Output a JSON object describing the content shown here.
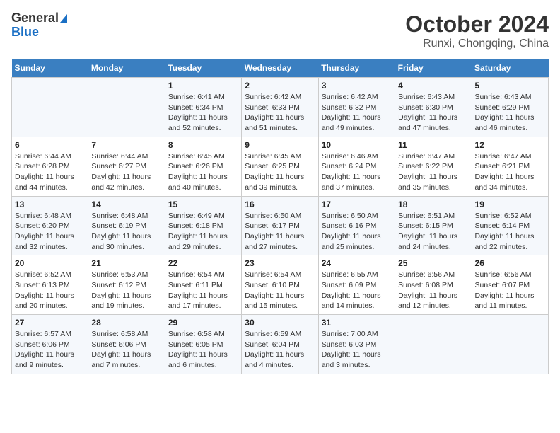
{
  "header": {
    "logo_general": "General",
    "logo_blue": "Blue",
    "title": "October 2024",
    "subtitle": "Runxi, Chongqing, China"
  },
  "weekdays": [
    "Sunday",
    "Monday",
    "Tuesday",
    "Wednesday",
    "Thursday",
    "Friday",
    "Saturday"
  ],
  "weeks": [
    [
      {
        "day": "",
        "info": ""
      },
      {
        "day": "",
        "info": ""
      },
      {
        "day": "1",
        "info": "Sunrise: 6:41 AM\nSunset: 6:34 PM\nDaylight: 11 hours and 52 minutes."
      },
      {
        "day": "2",
        "info": "Sunrise: 6:42 AM\nSunset: 6:33 PM\nDaylight: 11 hours and 51 minutes."
      },
      {
        "day": "3",
        "info": "Sunrise: 6:42 AM\nSunset: 6:32 PM\nDaylight: 11 hours and 49 minutes."
      },
      {
        "day": "4",
        "info": "Sunrise: 6:43 AM\nSunset: 6:30 PM\nDaylight: 11 hours and 47 minutes."
      },
      {
        "day": "5",
        "info": "Sunrise: 6:43 AM\nSunset: 6:29 PM\nDaylight: 11 hours and 46 minutes."
      }
    ],
    [
      {
        "day": "6",
        "info": "Sunrise: 6:44 AM\nSunset: 6:28 PM\nDaylight: 11 hours and 44 minutes."
      },
      {
        "day": "7",
        "info": "Sunrise: 6:44 AM\nSunset: 6:27 PM\nDaylight: 11 hours and 42 minutes."
      },
      {
        "day": "8",
        "info": "Sunrise: 6:45 AM\nSunset: 6:26 PM\nDaylight: 11 hours and 40 minutes."
      },
      {
        "day": "9",
        "info": "Sunrise: 6:45 AM\nSunset: 6:25 PM\nDaylight: 11 hours and 39 minutes."
      },
      {
        "day": "10",
        "info": "Sunrise: 6:46 AM\nSunset: 6:24 PM\nDaylight: 11 hours and 37 minutes."
      },
      {
        "day": "11",
        "info": "Sunrise: 6:47 AM\nSunset: 6:22 PM\nDaylight: 11 hours and 35 minutes."
      },
      {
        "day": "12",
        "info": "Sunrise: 6:47 AM\nSunset: 6:21 PM\nDaylight: 11 hours and 34 minutes."
      }
    ],
    [
      {
        "day": "13",
        "info": "Sunrise: 6:48 AM\nSunset: 6:20 PM\nDaylight: 11 hours and 32 minutes."
      },
      {
        "day": "14",
        "info": "Sunrise: 6:48 AM\nSunset: 6:19 PM\nDaylight: 11 hours and 30 minutes."
      },
      {
        "day": "15",
        "info": "Sunrise: 6:49 AM\nSunset: 6:18 PM\nDaylight: 11 hours and 29 minutes."
      },
      {
        "day": "16",
        "info": "Sunrise: 6:50 AM\nSunset: 6:17 PM\nDaylight: 11 hours and 27 minutes."
      },
      {
        "day": "17",
        "info": "Sunrise: 6:50 AM\nSunset: 6:16 PM\nDaylight: 11 hours and 25 minutes."
      },
      {
        "day": "18",
        "info": "Sunrise: 6:51 AM\nSunset: 6:15 PM\nDaylight: 11 hours and 24 minutes."
      },
      {
        "day": "19",
        "info": "Sunrise: 6:52 AM\nSunset: 6:14 PM\nDaylight: 11 hours and 22 minutes."
      }
    ],
    [
      {
        "day": "20",
        "info": "Sunrise: 6:52 AM\nSunset: 6:13 PM\nDaylight: 11 hours and 20 minutes."
      },
      {
        "day": "21",
        "info": "Sunrise: 6:53 AM\nSunset: 6:12 PM\nDaylight: 11 hours and 19 minutes."
      },
      {
        "day": "22",
        "info": "Sunrise: 6:54 AM\nSunset: 6:11 PM\nDaylight: 11 hours and 17 minutes."
      },
      {
        "day": "23",
        "info": "Sunrise: 6:54 AM\nSunset: 6:10 PM\nDaylight: 11 hours and 15 minutes."
      },
      {
        "day": "24",
        "info": "Sunrise: 6:55 AM\nSunset: 6:09 PM\nDaylight: 11 hours and 14 minutes."
      },
      {
        "day": "25",
        "info": "Sunrise: 6:56 AM\nSunset: 6:08 PM\nDaylight: 11 hours and 12 minutes."
      },
      {
        "day": "26",
        "info": "Sunrise: 6:56 AM\nSunset: 6:07 PM\nDaylight: 11 hours and 11 minutes."
      }
    ],
    [
      {
        "day": "27",
        "info": "Sunrise: 6:57 AM\nSunset: 6:06 PM\nDaylight: 11 hours and 9 minutes."
      },
      {
        "day": "28",
        "info": "Sunrise: 6:58 AM\nSunset: 6:06 PM\nDaylight: 11 hours and 7 minutes."
      },
      {
        "day": "29",
        "info": "Sunrise: 6:58 AM\nSunset: 6:05 PM\nDaylight: 11 hours and 6 minutes."
      },
      {
        "day": "30",
        "info": "Sunrise: 6:59 AM\nSunset: 6:04 PM\nDaylight: 11 hours and 4 minutes."
      },
      {
        "day": "31",
        "info": "Sunrise: 7:00 AM\nSunset: 6:03 PM\nDaylight: 11 hours and 3 minutes."
      },
      {
        "day": "",
        "info": ""
      },
      {
        "day": "",
        "info": ""
      }
    ]
  ]
}
